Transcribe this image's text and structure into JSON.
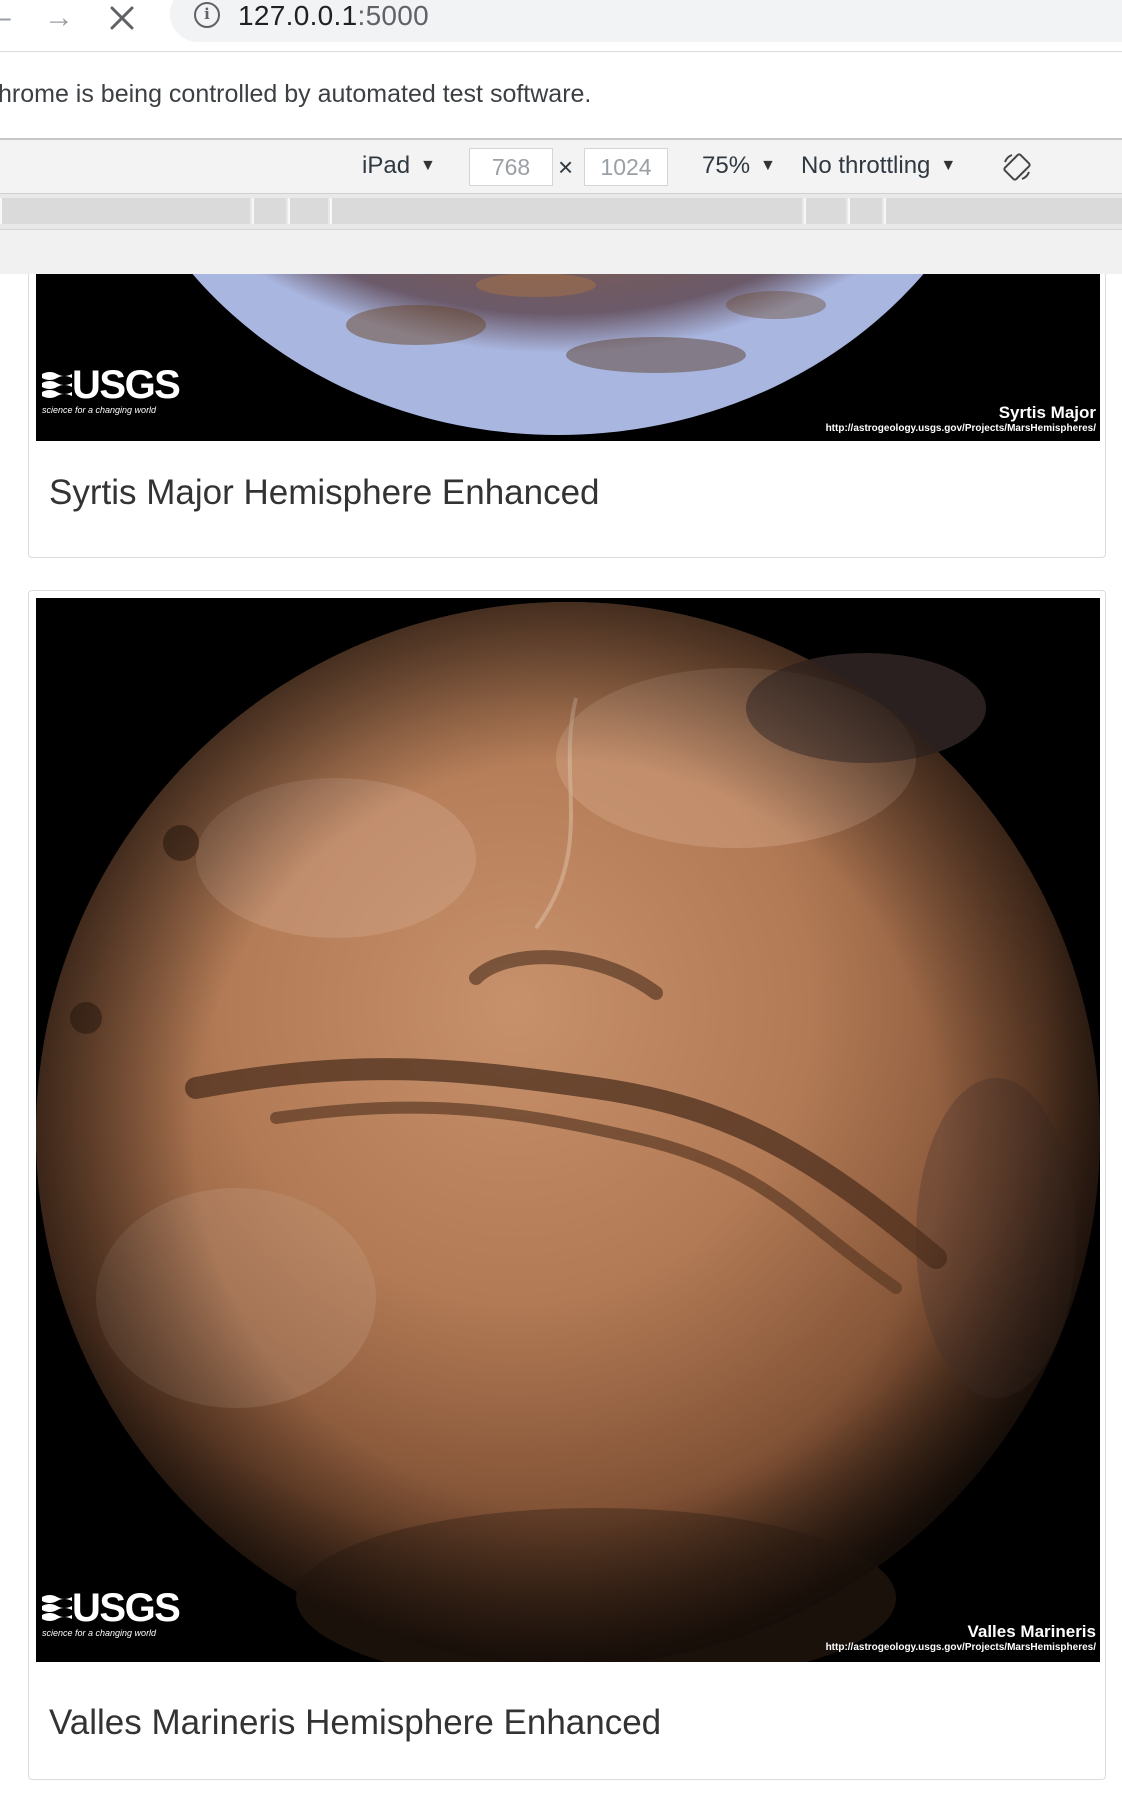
{
  "browser": {
    "back_icon": "back-arrow-icon",
    "forward_icon": "forward-arrow-icon",
    "stop_icon": "stop-icon",
    "url_host": "127.0.0.1",
    "url_port": ":5000",
    "infobar_text": "hrome is being controlled by automated test software."
  },
  "device_toolbar": {
    "device": "iPad",
    "width": "768",
    "height": "1024",
    "times": "×",
    "zoom": "75%",
    "throttling": "No throttling",
    "rotate_icon": "rotate-icon"
  },
  "cards": [
    {
      "title": "Syrtis Major Hemisphere Enhanced",
      "logo_text": "USGS",
      "logo_tagline": "science for a changing world",
      "caption_name": "Syrtis Major",
      "caption_url": "http://astrogeology.usgs.gov/Projects/MarsHemispheres/"
    },
    {
      "title": "Valles Marineris Hemisphere Enhanced",
      "logo_text": "USGS",
      "logo_tagline": "science for a changing world",
      "caption_name": "Valles Marineris",
      "caption_url": "http://astrogeology.usgs.gov/Projects/MarsHemispheres/"
    }
  ]
}
